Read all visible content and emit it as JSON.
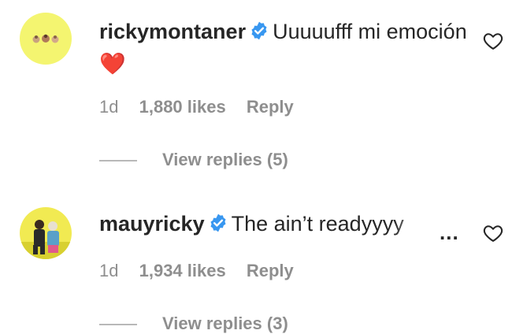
{
  "comments": [
    {
      "username": "rickymontaner",
      "text": "Uuuuufff mi emoción ",
      "emoji": "❤️",
      "time": "1d",
      "likes": "1,880 likes",
      "reply_label": "Reply",
      "view_replies": "View replies (5)",
      "verified": true
    },
    {
      "username": "mauyricky",
      "text": "The ain’t readyyyy",
      "ellipsis": "...",
      "time": "1d",
      "likes": "1,934 likes",
      "reply_label": "Reply",
      "view_replies": "View replies (3)",
      "verified": true
    }
  ],
  "colors": {
    "verified": "#3897f0",
    "meta": "#8e8e8e",
    "text": "#262626",
    "heart_emoji": "#e0245e"
  },
  "icons": {
    "like": "heart-outline-icon",
    "verified": "verified-badge-icon",
    "more": "more-options-icon"
  }
}
